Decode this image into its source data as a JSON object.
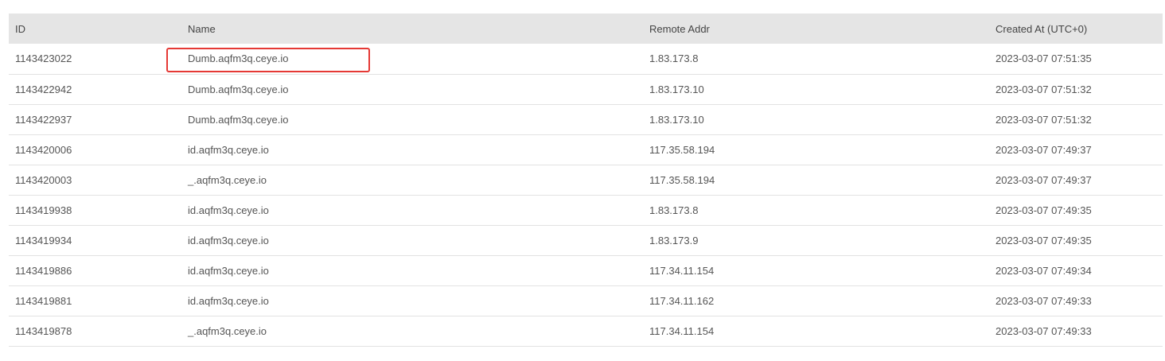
{
  "table": {
    "columns": [
      "ID",
      "Name",
      "Remote Addr",
      "Created At (UTC+0)"
    ],
    "rows": [
      {
        "id": "1143423022",
        "name": "Dumb.aqfm3q.ceye.io",
        "remote_addr": "1.83.173.8",
        "created_at": "2023-03-07 07:51:35"
      },
      {
        "id": "1143422942",
        "name": "Dumb.aqfm3q.ceye.io",
        "remote_addr": "1.83.173.10",
        "created_at": "2023-03-07 07:51:32"
      },
      {
        "id": "1143422937",
        "name": "Dumb.aqfm3q.ceye.io",
        "remote_addr": "1.83.173.10",
        "created_at": "2023-03-07 07:51:32"
      },
      {
        "id": "1143420006",
        "name": "id.aqfm3q.ceye.io",
        "remote_addr": "117.35.58.194",
        "created_at": "2023-03-07 07:49:37"
      },
      {
        "id": "1143420003",
        "name": "_.aqfm3q.ceye.io",
        "remote_addr": "117.35.58.194",
        "created_at": "2023-03-07 07:49:37"
      },
      {
        "id": "1143419938",
        "name": "id.aqfm3q.ceye.io",
        "remote_addr": "1.83.173.8",
        "created_at": "2023-03-07 07:49:35"
      },
      {
        "id": "1143419934",
        "name": "id.aqfm3q.ceye.io",
        "remote_addr": "1.83.173.9",
        "created_at": "2023-03-07 07:49:35"
      },
      {
        "id": "1143419886",
        "name": "id.aqfm3q.ceye.io",
        "remote_addr": "117.34.11.154",
        "created_at": "2023-03-07 07:49:34"
      },
      {
        "id": "1143419881",
        "name": "id.aqfm3q.ceye.io",
        "remote_addr": "117.34.11.162",
        "created_at": "2023-03-07 07:49:33"
      },
      {
        "id": "1143419878",
        "name": "_.aqfm3q.ceye.io",
        "remote_addr": "117.34.11.154",
        "created_at": "2023-03-07 07:49:33"
      }
    ]
  },
  "annotation": {
    "highlight_color": "#e53935",
    "highlighted_cell": "row 1 / Name"
  }
}
